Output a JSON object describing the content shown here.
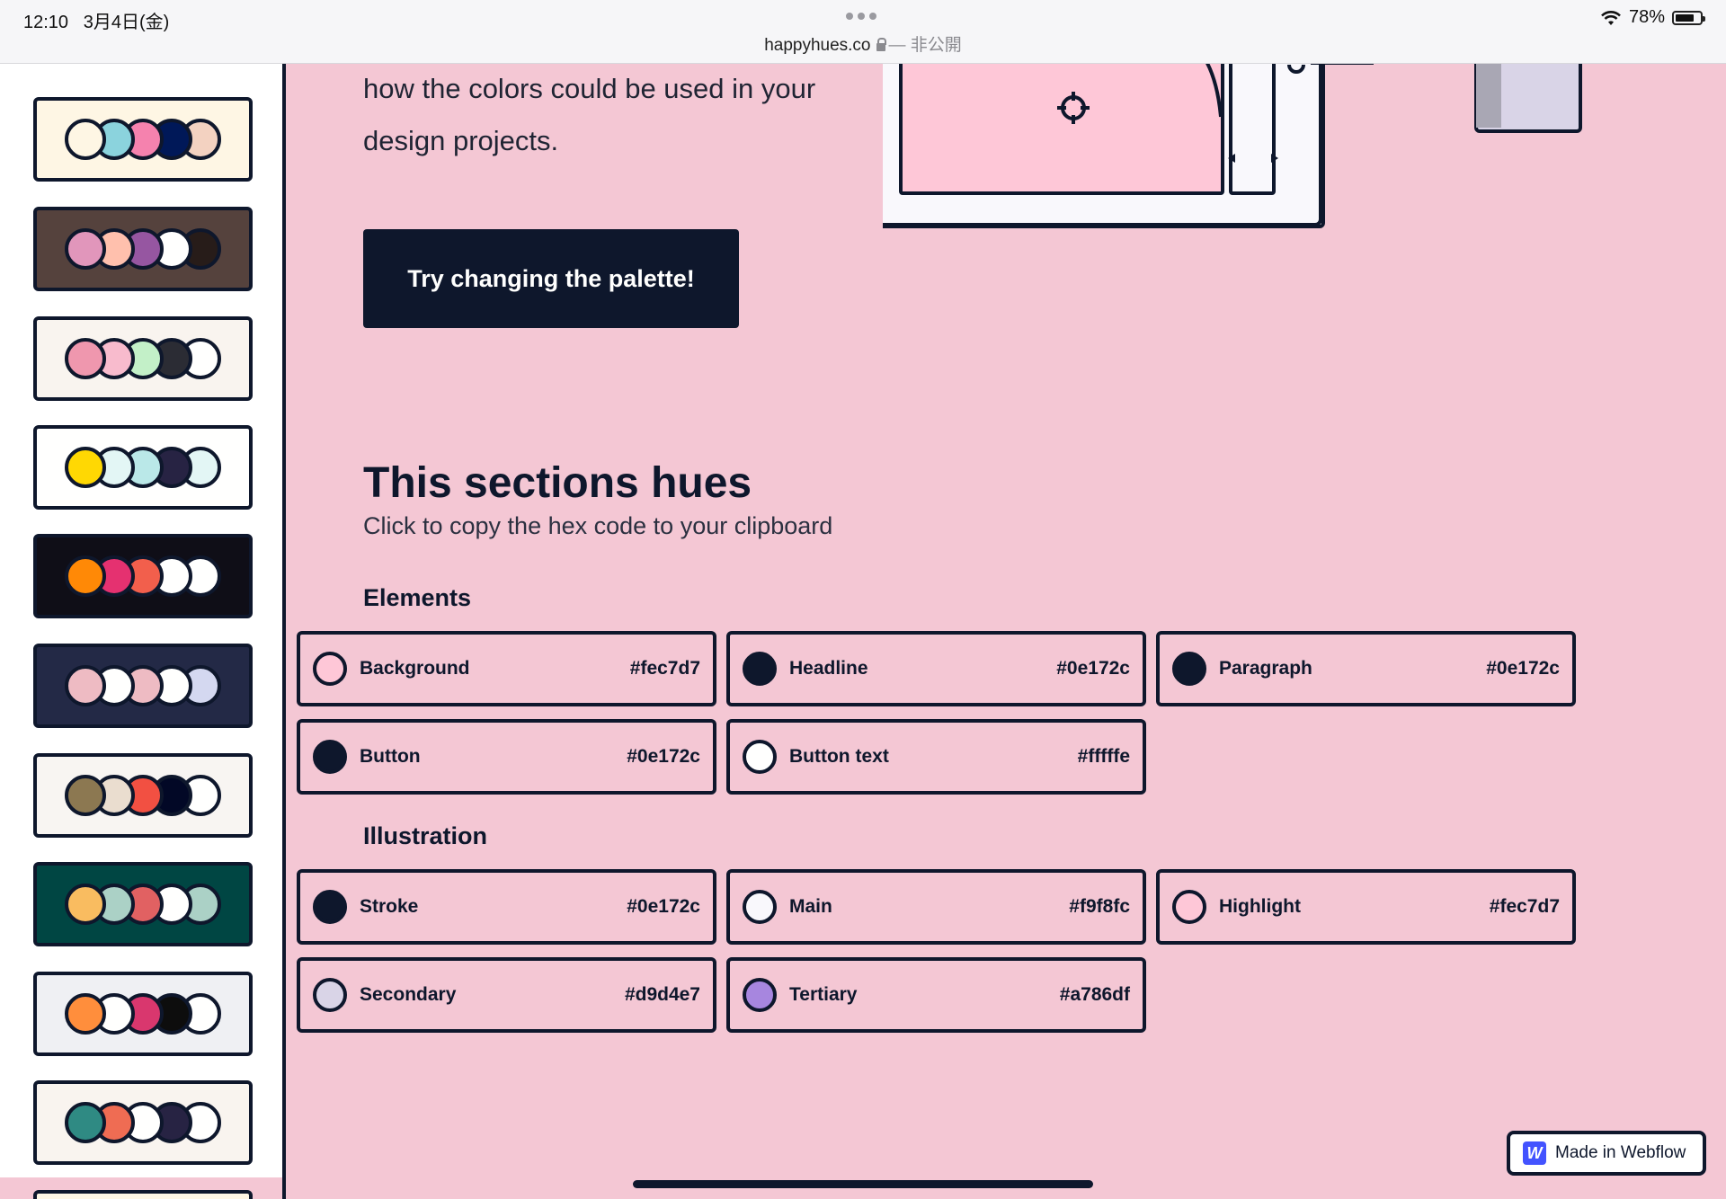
{
  "status_bar": {
    "time": "12:10",
    "date": "3月4日(金)",
    "url": "happyhues.co",
    "privacy": "— 非公開",
    "battery": "78%",
    "battery_level": 0.78
  },
  "sidebar": {
    "palettes": [
      {
        "bg": "#fef6e4",
        "colors": [
          "#fef6e4",
          "#8bd3dd",
          "#f582ae",
          "#001858",
          "#f3d2c1"
        ]
      },
      {
        "bg": "#55423d",
        "colors": [
          "#e196bb",
          "#ffc0ad",
          "#9656a1",
          "#fffffe",
          "#271c19"
        ]
      },
      {
        "bg": "#f9f4ef",
        "colors": [
          "#ef97ae",
          "#f8bbcd",
          "#c3f0c8",
          "#2b2c34",
          "#fffffe"
        ]
      },
      {
        "bg": "#fffffe",
        "colors": [
          "#ffd803",
          "#e3f6f5",
          "#bae8e8",
          "#272343",
          "#e3f6f5"
        ]
      },
      {
        "bg": "#0f0e17",
        "colors": [
          "#ff8906",
          "#e53170",
          "#f25f4c",
          "#fffffe",
          "#fffffe"
        ]
      },
      {
        "bg": "#232946",
        "colors": [
          "#eebbc3",
          "#fffffe",
          "#eebbc3",
          "#fffffe",
          "#d4d8f0"
        ]
      },
      {
        "bg": "#f8f5f2",
        "colors": [
          "#8c7851",
          "#eaddcf",
          "#f25042",
          "#020826",
          "#fffffe"
        ]
      },
      {
        "bg": "#004643",
        "colors": [
          "#f9bc60",
          "#abd1c6",
          "#e16162",
          "#fffffe",
          "#abd1c6"
        ]
      },
      {
        "bg": "#eff0f3",
        "colors": [
          "#ff8e3c",
          "#fffffe",
          "#d9376e",
          "#0d0d0d",
          "#fffffe"
        ]
      },
      {
        "bg": "#f9f4ef",
        "colors": [
          "#2f8a83",
          "#ef6c53",
          "#fffffe",
          "#272343",
          "#fffffe"
        ]
      }
    ]
  },
  "main": {
    "intro": "how the colors could be used in your design projects.",
    "cta_label": "Try changing the palette!",
    "section_title": "This sections hues",
    "section_subtitle": "Click to copy the hex code to your clipboard",
    "elements_label": "Elements",
    "illustration_label": "Illustration",
    "elements": [
      {
        "name": "Background",
        "hex": "#fec7d7",
        "color": "#fec7d7"
      },
      {
        "name": "Headline",
        "hex": "#0e172c",
        "color": "#0e172c"
      },
      {
        "name": "Paragraph",
        "hex": "#0e172c",
        "color": "#0e172c"
      },
      {
        "name": "Button",
        "hex": "#0e172c",
        "color": "#0e172c"
      },
      {
        "name": "Button text",
        "hex": "#fffffe",
        "color": "#fffffe"
      }
    ],
    "illustration": [
      {
        "name": "Stroke",
        "hex": "#0e172c",
        "color": "#0e172c"
      },
      {
        "name": "Main",
        "hex": "#f9f8fc",
        "color": "#f9f8fc"
      },
      {
        "name": "Highlight",
        "hex": "#fec7d7",
        "color": "#fec7d7"
      },
      {
        "name": "Secondary",
        "hex": "#d9d4e7",
        "color": "#d9d4e7"
      },
      {
        "name": "Tertiary",
        "hex": "#a786df",
        "color": "#a786df"
      }
    ]
  },
  "webflow_badge": {
    "logo": "W",
    "label": "Made in Webflow"
  },
  "colors": {
    "accent": "#0e172c",
    "page_bg": "#f4c7d4",
    "webflow": "#4353ff"
  }
}
